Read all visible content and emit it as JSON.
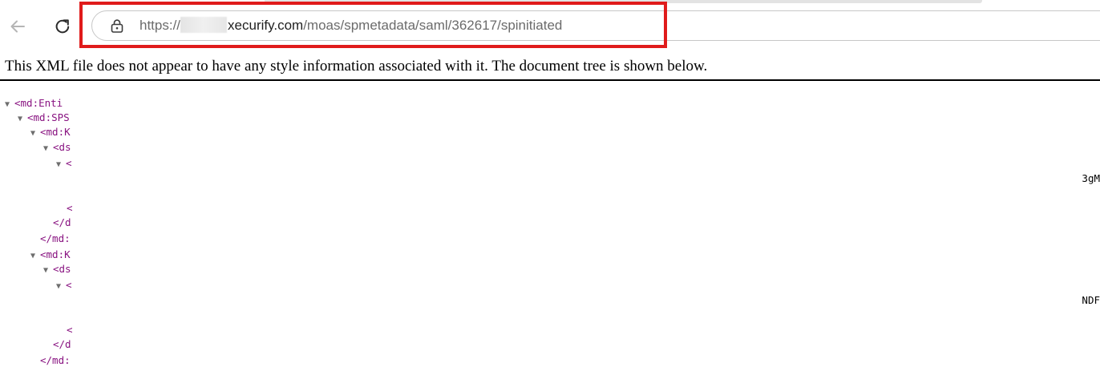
{
  "browser": {
    "back_icon": "arrow-left-icon",
    "reload_icon": "reload-icon",
    "lock_icon": "lock-icon",
    "url": {
      "scheme": "https://",
      "host": "xecurify.com",
      "path": "/moas/spmetadata/saml/362617/spinitiated"
    },
    "highlight_color": "#e01b1b"
  },
  "viewer": {
    "info": "This XML file does not appear to have any style information associated with it. The document tree is shown below.",
    "toggle_glyph": "▼",
    "lines": [
      {
        "toggle": true,
        "text": "<md:Enti"
      },
      {
        "toggle": true,
        "text": "<md:SPS"
      },
      {
        "toggle": true,
        "text": "<md:K"
      },
      {
        "toggle": true,
        "text": "<ds"
      },
      {
        "toggle": true,
        "text": "<"
      },
      {
        "toggle": false,
        "text": "<"
      },
      {
        "toggle": false,
        "text": "</d"
      },
      {
        "toggle": false,
        "text": "</md:"
      },
      {
        "toggle": true,
        "text": "<md:K"
      },
      {
        "toggle": true,
        "text": "<ds"
      },
      {
        "toggle": true,
        "text": "<"
      },
      {
        "toggle": false,
        "text": "<"
      },
      {
        "toggle": false,
        "text": "</d"
      },
      {
        "toggle": false,
        "text": "</md:"
      }
    ],
    "clipped_right": [
      "3gM",
      "NDF"
    ]
  }
}
